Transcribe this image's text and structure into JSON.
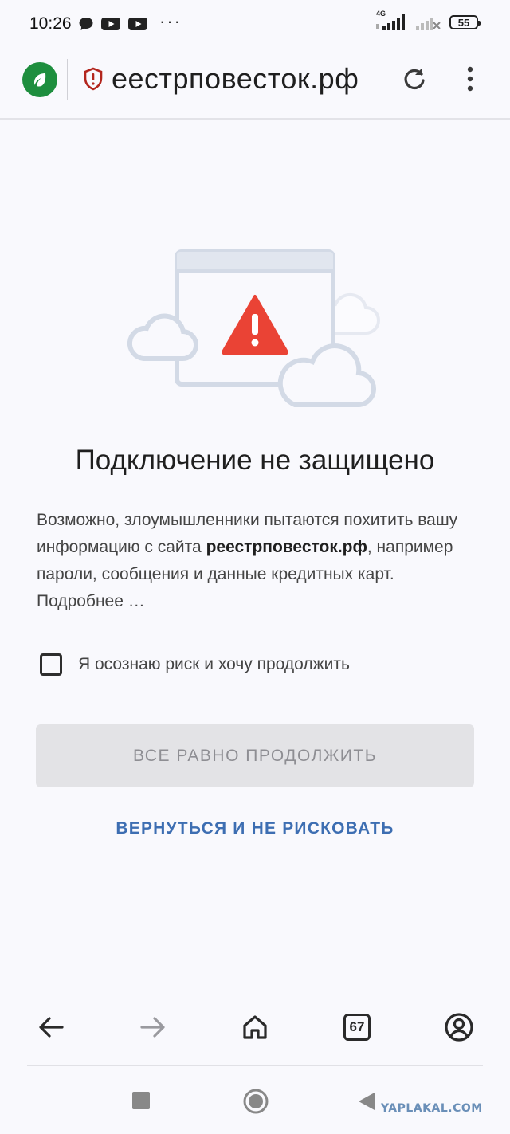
{
  "status_bar": {
    "time": "10:26",
    "network_type": "4G",
    "battery": "55",
    "more": "···"
  },
  "address_bar": {
    "url": "еестрповесток.рф"
  },
  "interstitial": {
    "title": "Подключение не защищено",
    "description_before": "Возможно, злоумышленники пытаются похитить вашу информацию с сайта ",
    "description_domain": "реестрповесток.рф",
    "description_after": ", например пароли, сообщения и данные кредитных карт. Подробнее …",
    "checkbox_label": "Я осознаю риск и хочу продолжить",
    "checkbox_checked": false,
    "proceed_button": "ВСЕ РАВНО ПРОДОЛЖИТЬ",
    "back_link": "ВЕРНУТЬСЯ И НЕ РИСКОВАТЬ"
  },
  "toolbar": {
    "tabs_count": "67"
  },
  "watermark": "YAPLAKAL.COM",
  "colors": {
    "brand_green": "#1e8e3e",
    "warning_red": "#ea4335",
    "link_blue": "#3d6eb2",
    "disabled_button": "#e3e3e6"
  }
}
